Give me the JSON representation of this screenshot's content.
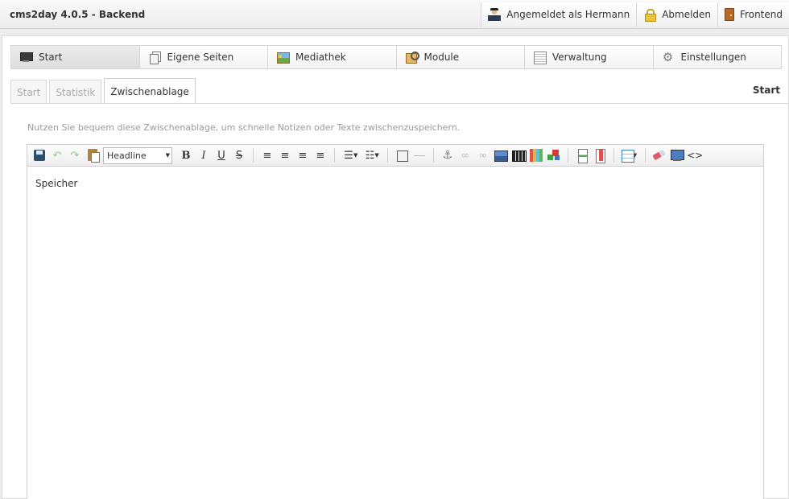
{
  "header": {
    "title": "cms2day 4.0.5 - Backend",
    "nav": [
      {
        "label": "Angemeldet als Hermann",
        "icon": "user-icon"
      },
      {
        "label": "Abmelden",
        "icon": "lock-icon"
      },
      {
        "label": "Frontend",
        "icon": "door-icon"
      }
    ]
  },
  "main_tabs": [
    {
      "label": "Start",
      "icon": "monitor-icon",
      "active": true
    },
    {
      "label": "Eigene Seiten",
      "icon": "pages-icon"
    },
    {
      "label": "Mediathek",
      "icon": "media-icon"
    },
    {
      "label": "Module",
      "icon": "modules-icon"
    },
    {
      "label": "Verwaltung",
      "icon": "admin-icon"
    },
    {
      "label": "Einstellungen",
      "icon": "gear-icon"
    }
  ],
  "sub_tabs": [
    {
      "label": "Start"
    },
    {
      "label": "Statistik"
    },
    {
      "label": "Zwischenablage",
      "active": true
    }
  ],
  "section_label": "Start",
  "hint": "Nutzen Sie bequem diese Zwischenablage, um schnelle Notizen oder Texte zwischenzuspeichern.",
  "editor": {
    "format_select": "Headline",
    "content": "Speicher",
    "toolbar_icons": [
      "save-icon",
      "undo-icon",
      "redo-icon",
      "paste-icon",
      "bold-icon",
      "italic-icon",
      "underline-icon",
      "strikethrough-icon",
      "align-left-icon",
      "align-center-icon",
      "align-right-icon",
      "align-justify-icon",
      "bullet-list-icon",
      "numbered-list-icon",
      "blockquote-icon",
      "horizontal-rule-icon",
      "anchor-icon",
      "link-icon",
      "unlink-icon",
      "image-icon",
      "video-icon",
      "media-library-icon",
      "module-icon",
      "page-break-icon",
      "pdf-icon",
      "table-icon",
      "remove-format-icon",
      "preview-icon",
      "source-code-icon"
    ],
    "glyphs": {
      "undo": "↶",
      "redo": "↷",
      "bold": "B",
      "italic": "I",
      "underline": "U",
      "strike": "S",
      "align_left": "≡",
      "align_center": "≡",
      "align_right": "≡",
      "align_justify": "≡",
      "bullets": "☰",
      "numbers": "☷",
      "caret": "▼",
      "anchor": "⚓",
      "link": "∞",
      "unlink": "∞",
      "source": "<>"
    }
  }
}
